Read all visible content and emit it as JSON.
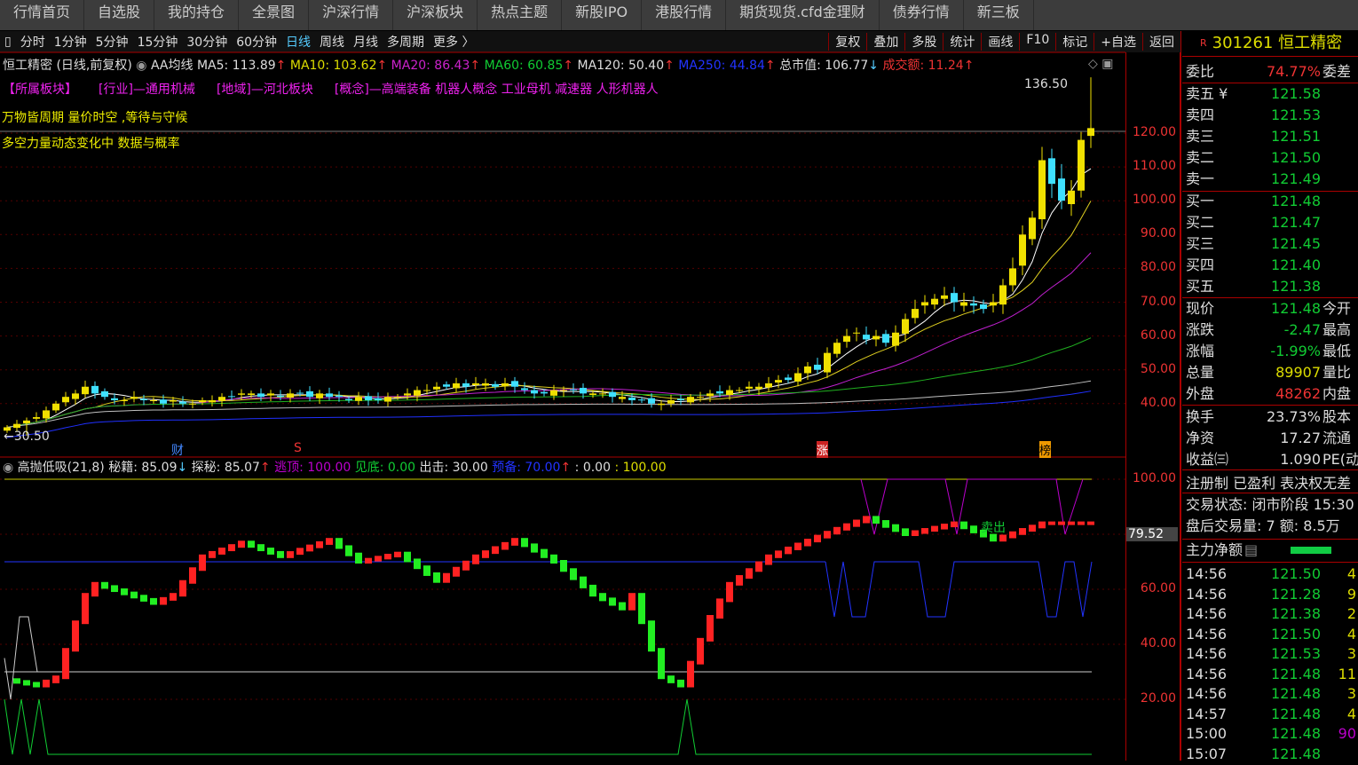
{
  "nav": [
    "行情首页",
    "自选股",
    "我的持仓",
    "全景图",
    "沪深行情",
    "沪深板块",
    "热点主题",
    "新股IPO",
    "港股行情",
    "期货现货.cfd金理财",
    "债券行情",
    "新三板"
  ],
  "toolbar": {
    "periods": [
      "分时",
      "1分钟",
      "5分钟",
      "15分钟",
      "30分钟",
      "60分钟",
      "日线",
      "周线",
      "月线",
      "多周期",
      "更多 〉"
    ],
    "active": "日线",
    "right": [
      "复权",
      "叠加",
      "多股",
      "统计",
      "画线",
      "F10",
      "标记",
      "+自选",
      "返回"
    ]
  },
  "main_title": {
    "name": "恒工精密 (日线,前复权)",
    "ma_label": "AA均线",
    "ma5": "MA5: 113.89",
    "ma10": "MA10: 103.62",
    "ma20": "MA20: 86.43",
    "ma60": "MA60: 60.85",
    "ma120": "MA120: 50.40",
    "ma250": "MA250: 44.84",
    "mktcap": "总市值: 106.77",
    "amount": "成交额: 11.24"
  },
  "sectors": [
    "【所属板块】",
    "[行业]—通用机械",
    "[地域]—河北板块",
    "[概念]—高端装备 机器人概念 工业母机 减速器 人形机器人"
  ],
  "notes": [
    "万物皆周期  量价时空 ,等待与守候",
    "多空力量动态变化中 数据与概率"
  ],
  "price_marks": {
    "high": "136.50",
    "low": "30.50",
    "events": [
      "财",
      "S",
      "涨",
      "榜"
    ]
  },
  "price_axis": [
    "120.00",
    "110.00",
    "100.00",
    "90.00",
    "80.00",
    "70.00",
    "60.00",
    "50.00",
    "40.00"
  ],
  "ind_axis": [
    "100.00",
    "60.00",
    "40.00",
    "20.00"
  ],
  "ind_current": "79.52",
  "ind_title": {
    "name": "高抛低吸(21,8)",
    "a": "秘籍: 85.09",
    "b": "探秘: 85.07",
    "c": "逃顶: 100.00",
    "d": "见底: 0.00",
    "e": "出击: 30.00",
    "f": "预备: 70.00",
    "g": ": 0.00",
    "h": ": 100.00",
    "sell": "卖出"
  },
  "colors": {
    "up": "#f0e000",
    "down": "#3fe0ff",
    "ma5": "#ffffff",
    "ma10": "#e0d020",
    "ma20": "#c020d0",
    "ma60": "#20b020",
    "ma120": "#c0c0c0",
    "ma250": "#2030ff"
  },
  "chart_data": {
    "type": "candlestick",
    "closes": [
      33,
      34,
      35,
      36,
      38,
      40,
      42,
      43,
      45,
      43,
      42,
      41,
      41,
      42,
      41,
      41,
      40,
      41,
      40,
      40,
      41,
      41,
      42,
      42,
      43,
      43,
      42,
      43,
      42,
      43,
      43,
      42,
      43,
      42,
      42,
      41,
      42,
      41,
      41,
      42,
      42,
      43,
      44,
      44,
      45,
      45,
      46,
      45,
      46,
      46,
      45,
      46,
      45,
      44,
      43,
      43,
      44,
      44,
      44,
      43,
      43,
      43,
      42,
      42,
      41,
      41,
      40,
      40,
      41,
      41,
      42,
      42,
      43,
      43,
      44,
      44,
      45,
      45,
      46,
      47,
      47,
      49,
      51,
      50,
      55,
      58,
      60,
      61,
      59,
      60,
      58,
      61,
      65,
      68,
      70,
      71,
      72,
      70,
      70,
      69,
      68,
      70,
      75,
      80,
      90,
      95,
      112,
      105,
      100,
      103,
      118,
      121.48
    ],
    "high": 136.5,
    "low": 30.5,
    "ylim": [
      30,
      130
    ],
    "indicator_keypoints": [
      [
        0,
        27
      ],
      [
        3,
        25
      ],
      [
        5,
        28
      ],
      [
        8,
        58
      ],
      [
        9,
        62
      ],
      [
        15,
        55
      ],
      [
        17,
        58
      ],
      [
        20,
        72
      ],
      [
        24,
        77
      ],
      [
        28,
        72
      ],
      [
        33,
        78
      ],
      [
        36,
        70
      ],
      [
        40,
        73
      ],
      [
        44,
        63
      ],
      [
        48,
        72
      ],
      [
        52,
        78
      ],
      [
        56,
        70
      ],
      [
        60,
        58
      ],
      [
        63,
        53
      ],
      [
        64,
        58
      ],
      [
        67,
        28
      ],
      [
        69,
        25
      ],
      [
        72,
        50
      ],
      [
        74,
        62
      ],
      [
        78,
        72
      ],
      [
        85,
        82
      ],
      [
        88,
        86
      ],
      [
        92,
        80
      ],
      [
        97,
        84
      ],
      [
        101,
        78
      ],
      [
        106,
        84
      ],
      [
        111,
        84
      ]
    ]
  },
  "panel": {
    "code": "301261 恒工精密",
    "r": "R",
    "weibi": {
      "l": "委比",
      "v": "74.77%",
      "s": "委差"
    },
    "asks": [
      [
        "卖五 ¥",
        "121.58"
      ],
      [
        "卖四",
        "121.53"
      ],
      [
        "卖三",
        "121.51"
      ],
      [
        "卖二",
        "121.50"
      ],
      [
        "卖一",
        "121.49"
      ]
    ],
    "bids": [
      [
        "买一",
        "121.48"
      ],
      [
        "买二",
        "121.47"
      ],
      [
        "买三",
        "121.45"
      ],
      [
        "买四",
        "121.40"
      ],
      [
        "买五",
        "121.38"
      ]
    ],
    "stats1": [
      [
        "现价",
        "121.48",
        "今开",
        "g"
      ],
      [
        "涨跌",
        "-2.47",
        "最高",
        "g"
      ],
      [
        "涨幅",
        "-1.99%",
        "最低",
        "g"
      ],
      [
        "总量",
        "89907",
        "量比",
        "y"
      ],
      [
        "外盘",
        "48262",
        "内盘",
        "rd"
      ]
    ],
    "stats2": [
      [
        "换手",
        "23.73%",
        "股本"
      ],
      [
        "净资",
        "17.27",
        "流通"
      ],
      [
        "收益㈢",
        "1.090",
        "PE(动"
      ]
    ],
    "reg": "注册制 已盈利 表决权无差",
    "status": "交易状态: 闭市阶段 15:30",
    "after": "盘后交易量: 7  额: 8.5万",
    "main_flow": "主力净额",
    "ticks": [
      [
        "14:56",
        "121.50",
        "4",
        "y"
      ],
      [
        "14:56",
        "121.28",
        "9",
        "y"
      ],
      [
        "14:56",
        "121.38",
        "2",
        "y"
      ],
      [
        "14:56",
        "121.50",
        "4",
        "y"
      ],
      [
        "14:56",
        "121.53",
        "3",
        "y"
      ],
      [
        "14:56",
        "121.48",
        "11",
        "y"
      ],
      [
        "14:56",
        "121.48",
        "3",
        "y"
      ],
      [
        "14:57",
        "121.48",
        "4",
        "y"
      ],
      [
        "15:00",
        "121.48",
        "90",
        "m"
      ],
      [
        "15:07",
        "121.48",
        "",
        ""
      ]
    ]
  }
}
